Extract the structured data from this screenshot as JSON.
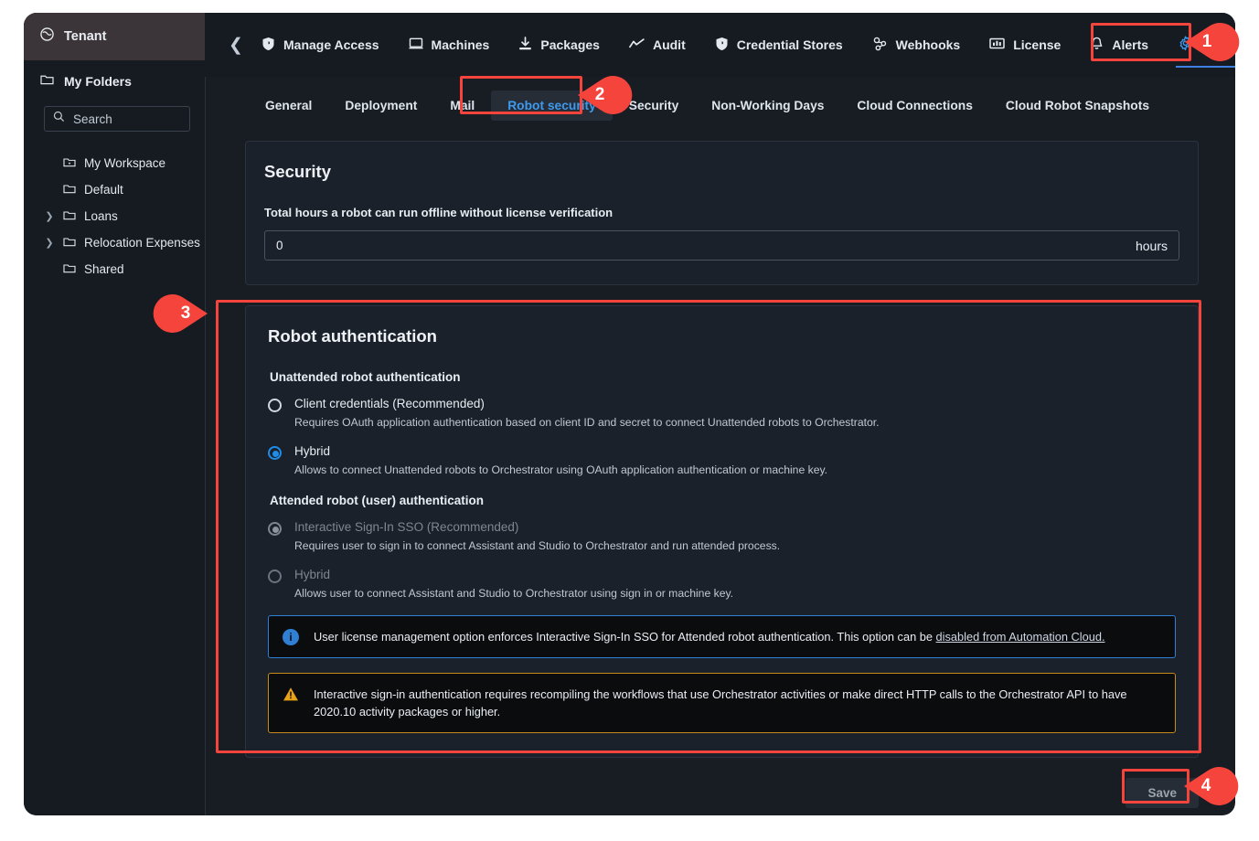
{
  "sidebar": {
    "tenant": {
      "label": "Tenant",
      "icon": "globe-icon"
    },
    "my_folders": {
      "label": "My Folders",
      "icon": "folder-icon"
    },
    "search": {
      "placeholder": "Search",
      "icon": "search-icon"
    },
    "tree": [
      {
        "label": "My Workspace",
        "icon": "workspace-folder-icon",
        "expandable": false
      },
      {
        "label": "Default",
        "icon": "folder-icon",
        "expandable": false
      },
      {
        "label": "Loans",
        "icon": "folder-icon",
        "expandable": true
      },
      {
        "label": "Relocation Expenses",
        "icon": "folder-icon",
        "expandable": true
      },
      {
        "label": "Shared",
        "icon": "folder-icon",
        "expandable": false
      }
    ]
  },
  "topnav": {
    "collapse_icon": "chevron-left-icon",
    "items": [
      {
        "label": "Manage Access",
        "icon": "shield-icon",
        "active": false
      },
      {
        "label": "Machines",
        "icon": "monitor-icon",
        "active": false
      },
      {
        "label": "Packages",
        "icon": "download-icon",
        "active": false
      },
      {
        "label": "Audit",
        "icon": "trend-line-icon",
        "active": false
      },
      {
        "label": "Credential Stores",
        "icon": "shield-icon",
        "active": false
      },
      {
        "label": "Webhooks",
        "icon": "webhook-icon",
        "active": false
      },
      {
        "label": "License",
        "icon": "license-icon",
        "active": false
      },
      {
        "label": "Alerts",
        "icon": "bell-icon",
        "active": false
      },
      {
        "label": "Settings",
        "icon": "gear-icon",
        "active": true
      }
    ]
  },
  "subtabs": [
    {
      "label": "General",
      "active": false
    },
    {
      "label": "Deployment",
      "active": false
    },
    {
      "label": "Mail",
      "active": false
    },
    {
      "label": "Robot security",
      "active": true
    },
    {
      "label": "Security",
      "active": false
    },
    {
      "label": "Non-Working Days",
      "active": false
    },
    {
      "label": "Cloud Connections",
      "active": false
    },
    {
      "label": "Cloud Robot Snapshots",
      "active": false
    }
  ],
  "security_card": {
    "title": "Security",
    "field_label": "Total hours a robot can run offline without license verification",
    "value": "0",
    "suffix": "hours"
  },
  "robot_auth_card": {
    "title": "Robot authentication",
    "unattended": {
      "heading": "Unattended robot authentication",
      "options": [
        {
          "label": "Client credentials (Recommended)",
          "description": "Requires OAuth application authentication based on client ID and secret to connect Unattended robots to Orchestrator.",
          "selected": false,
          "disabled": false
        },
        {
          "label": "Hybrid",
          "description": "Allows to connect Unattended robots to Orchestrator using OAuth application authentication or machine key.",
          "selected": true,
          "disabled": false
        }
      ]
    },
    "attended": {
      "heading": "Attended robot (user) authentication",
      "options": [
        {
          "label": "Interactive Sign-In SSO (Recommended)",
          "description": "Requires user to sign in to connect Assistant and Studio to Orchestrator and run attended process.",
          "selected": true,
          "disabled": true
        },
        {
          "label": "Hybrid",
          "description": "Allows user to connect Assistant and Studio to Orchestrator using sign in or machine key.",
          "selected": false,
          "disabled": true
        }
      ]
    },
    "info_alert": {
      "icon": "info-icon",
      "text": "User license management option enforces Interactive Sign-In SSO for Attended robot authentication. This option can be ",
      "link_text": "disabled from Automation Cloud."
    },
    "warning_alert": {
      "icon": "warning-icon",
      "text": "Interactive sign-in authentication requires recompiling the workflows that use Orchestrator activities or make direct HTTP calls to the Orchestrator API to have 2020.10 activity packages or higher."
    }
  },
  "footer": {
    "save_label": "Save"
  },
  "annotations": [
    {
      "number": "1",
      "target": "settings-nav-item"
    },
    {
      "number": "2",
      "target": "robot-security-tab"
    },
    {
      "number": "3",
      "target": "robot-authentication-card"
    },
    {
      "number": "4",
      "target": "save-button"
    }
  ],
  "colors": {
    "accent_blue": "#3d9aee",
    "radio_blue": "#1f8ce8",
    "annotation_red": "#f4443c",
    "info_border": "#2f7fd4",
    "warning_border": "#c88a1b",
    "page_bg": "#181d24",
    "card_bg": "#1b212a"
  }
}
